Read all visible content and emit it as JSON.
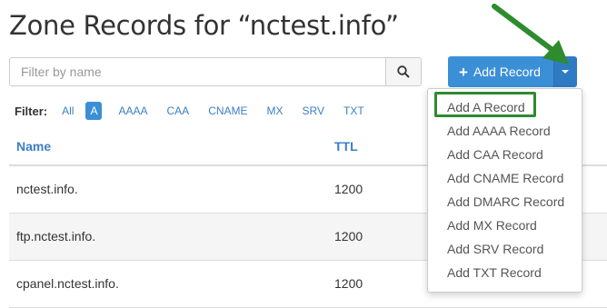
{
  "page": {
    "title": "Zone Records for “nctest.info”"
  },
  "search": {
    "placeholder": "Filter by name"
  },
  "add_record": {
    "label": "Add Record"
  },
  "filter": {
    "label": "Filter:",
    "items": [
      "All",
      "A",
      "AAAA",
      "CAA",
      "CNAME",
      "MX",
      "SRV",
      "TXT"
    ],
    "active": "A"
  },
  "table": {
    "columns": [
      "Name",
      "TTL"
    ],
    "rows": [
      {
        "name": "nctest.info.",
        "ttl": "1200"
      },
      {
        "name": "ftp.nctest.info.",
        "ttl": "1200"
      },
      {
        "name": "cpanel.nctest.info.",
        "ttl": "1200"
      }
    ]
  },
  "dropdown": {
    "items": [
      "Add A Record",
      "Add AAAA Record",
      "Add CAA Record",
      "Add CNAME Record",
      "Add DMARC Record",
      "Add MX Record",
      "Add SRV Record",
      "Add TXT Record"
    ]
  },
  "colors": {
    "accent": "#3b8fd6",
    "highlight": "#2e8b2e"
  }
}
